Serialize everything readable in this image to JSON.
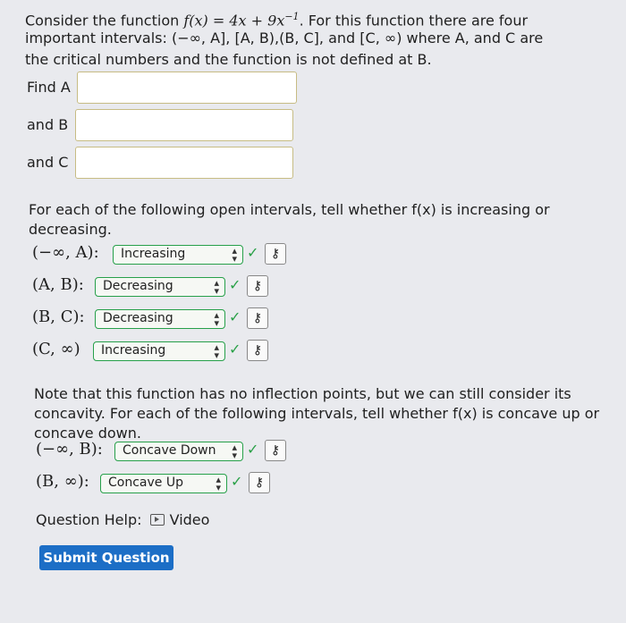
{
  "question": {
    "p1_a": "Consider the function ",
    "func": "f(x) = 4x + 9x",
    "func_exp": "−1",
    "p1_b": ". For this function there are four",
    "p2": "important intervals: (−∞, A], [A, B),(B, C], and [C, ∞) where A, and C are",
    "p3": "the critical numbers and the function is not defined at B."
  },
  "inputs": {
    "find_a": {
      "label": "Find A",
      "value": ""
    },
    "and_b": {
      "label": "and B",
      "value": ""
    },
    "and_c": {
      "label": "and C",
      "value": ""
    }
  },
  "increasing": {
    "instruction_1": "For each of the following open intervals, tell whether f(x) is increasing or",
    "instruction_2": "decreasing.",
    "rows": [
      {
        "interval": "(−∞, A):",
        "value": "Increasing"
      },
      {
        "interval": "(A, B):",
        "value": "Decreasing"
      },
      {
        "interval": "(B, C):",
        "value": "Decreasing"
      },
      {
        "interval": "(C, ∞)",
        "value": "Increasing"
      }
    ]
  },
  "concavity": {
    "note_1": "Note that this function has no inflection points, but we can still consider its",
    "note_2": "concavity. For each of the following intervals, tell whether f(x) is concave up or",
    "note_3": "concave down.",
    "rows": [
      {
        "interval": "(−∞, B):",
        "value": "Concave Down"
      },
      {
        "interval": "(B, ∞):",
        "value": "Concave Up"
      }
    ]
  },
  "help": {
    "label": "Question Help:",
    "video": "Video"
  },
  "submit_label": "Submit Question",
  "colors": {
    "accent": "#1c6ec6",
    "correct": "#2aa148",
    "input_border": "#c7bc84"
  },
  "icons": {
    "correct": "check-icon",
    "key": "key-icon",
    "video": "video-icon"
  }
}
